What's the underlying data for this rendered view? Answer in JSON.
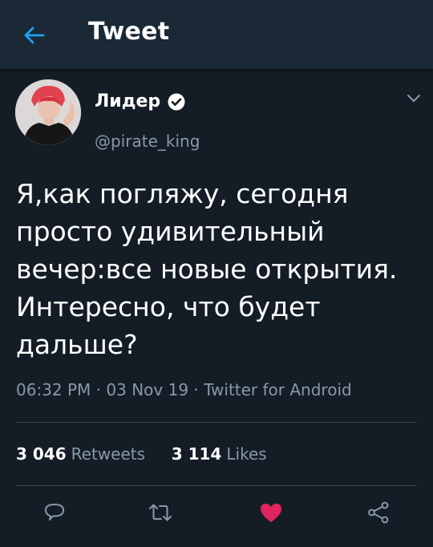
{
  "header": {
    "title": "Tweet"
  },
  "author": {
    "display_name": "Лидер",
    "handle": "@pirate_king",
    "verified": true
  },
  "tweet": {
    "lines": [
      "Я,как погляжу, сегодня",
      "просто удивительный",
      "вечер:все новые открытия.",
      "Интересно, что будет",
      "дальше?"
    ]
  },
  "meta": {
    "time": "06:32 PM",
    "date": "03 Nov 19",
    "client": "Twitter for Android",
    "separator": "·"
  },
  "stats": {
    "retweets_count": "3 046",
    "retweets_label": "Retweets",
    "likes_count": "3 114",
    "likes_label": "Likes"
  },
  "actions": [
    {
      "icon": "reply-icon"
    },
    {
      "icon": "retweet-icon"
    },
    {
      "icon": "like-icon"
    },
    {
      "icon": "share-icon"
    }
  ],
  "colors": {
    "background": "#141d26",
    "header": "#1b2836",
    "accent": "#1da1f2",
    "muted": "#8899a6",
    "like": "#e0245e",
    "divider": "#38444d"
  }
}
